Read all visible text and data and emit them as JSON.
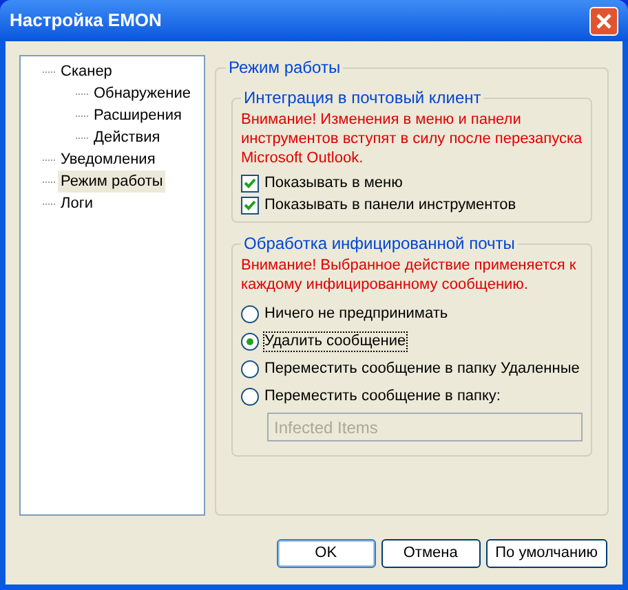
{
  "window": {
    "title": "Настройка EMON"
  },
  "tree": [
    {
      "label": "Сканер",
      "selected": false,
      "children": [
        {
          "label": "Обнаружение",
          "selected": false
        },
        {
          "label": "Расширения",
          "selected": false
        },
        {
          "label": "Действия",
          "selected": false
        }
      ]
    },
    {
      "label": "Уведомления",
      "selected": false
    },
    {
      "label": "Режим работы",
      "selected": true
    },
    {
      "label": "Логи",
      "selected": false
    }
  ],
  "panel": {
    "title": "Режим работы",
    "integration": {
      "title": "Интеграция в почтовый клиент",
      "warning": "Внимание! Изменения в меню и панели инструментов вступят в силу после перезапуска Microsoft Outlook.",
      "options": [
        {
          "label": "Показывать в меню",
          "checked": true
        },
        {
          "label": "Показывать в панели инструментов",
          "checked": true
        }
      ]
    },
    "infected": {
      "title": "Обработка инфицированной почты",
      "warning": "Внимание! Выбранное действие применяется к каждому инфицированному сообщению.",
      "options": [
        {
          "label": "Ничего не предпринимать",
          "selected": false
        },
        {
          "label": "Удалить сообщение",
          "selected": true
        },
        {
          "label": "Переместить сообщение в папку Удаленные",
          "selected": false
        },
        {
          "label": "Переместить сообщение в папку:",
          "selected": false
        }
      ],
      "folder": {
        "value": "Infected Items",
        "disabled": true
      }
    }
  },
  "buttons": [
    {
      "label": "OK",
      "default": true
    },
    {
      "label": "Отмена",
      "default": false
    },
    {
      "label": "По умолчанию",
      "default": false
    }
  ]
}
